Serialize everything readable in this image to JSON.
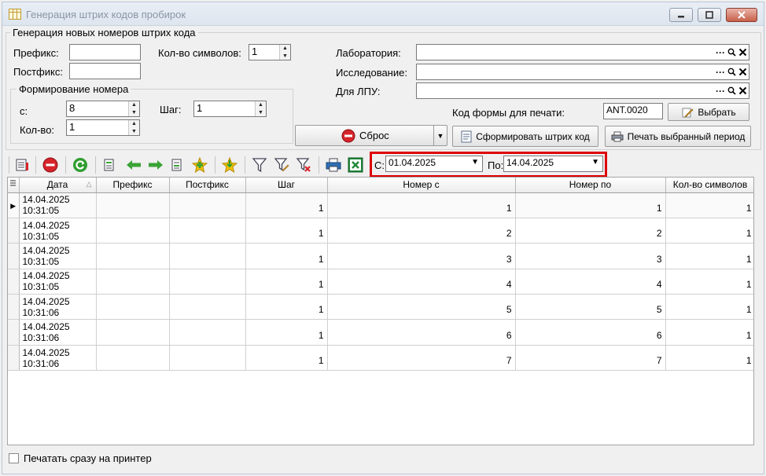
{
  "window": {
    "title": "Генерация штрих кодов пробирок"
  },
  "form": {
    "group_title": "Генерация новых номеров штрих кода",
    "prefix_label": "Префикс:",
    "prefix_value": "",
    "postfix_label": "Постфикс:",
    "postfix_value": "",
    "chars_label": "Кол-во символов:",
    "chars_value": "1",
    "numbering_group": "Формирование номера",
    "from_label": "с:",
    "from_value": "8",
    "step_label": "Шаг:",
    "step_value": "1",
    "count_label": "Кол-во:",
    "count_value": "1",
    "lab_label": "Лаборатория:",
    "lab_value": "",
    "research_label": "Исследование:",
    "research_value": "",
    "lpu_label": "Для ЛПУ:",
    "lpu_value": "",
    "lookup_dots": "···",
    "print_form_label": "Код формы для печати:",
    "print_form_value": "ANT.0020",
    "choose_label": "Выбрать",
    "reset_label": "Сброс",
    "generate_label": "Сформировать штрих код",
    "print_period_label": "Печать выбранный период"
  },
  "filter": {
    "from_label": "С:",
    "from_value": "01.04.2025",
    "to_label": "По:",
    "to_value": "14.04.2025"
  },
  "table": {
    "columns": [
      "Дата",
      "Префикс",
      "Постфикс",
      "Шаг",
      "Номер с",
      "Номер по",
      "Кол-во символов"
    ],
    "rows": [
      {
        "date": "14.04.2025",
        "time": "10:31:05",
        "prefix": "",
        "postfix": "",
        "step": "1",
        "from": "1",
        "to": "1",
        "chars": "1"
      },
      {
        "date": "14.04.2025",
        "time": "10:31:05",
        "prefix": "",
        "postfix": "",
        "step": "1",
        "from": "2",
        "to": "2",
        "chars": "1"
      },
      {
        "date": "14.04.2025",
        "time": "10:31:05",
        "prefix": "",
        "postfix": "",
        "step": "1",
        "from": "3",
        "to": "3",
        "chars": "1"
      },
      {
        "date": "14.04.2025",
        "time": "10:31:05",
        "prefix": "",
        "postfix": "",
        "step": "1",
        "from": "4",
        "to": "4",
        "chars": "1"
      },
      {
        "date": "14.04.2025",
        "time": "10:31:06",
        "prefix": "",
        "postfix": "",
        "step": "1",
        "from": "5",
        "to": "5",
        "chars": "1"
      },
      {
        "date": "14.04.2025",
        "time": "10:31:06",
        "prefix": "",
        "postfix": "",
        "step": "1",
        "from": "6",
        "to": "6",
        "chars": "1"
      },
      {
        "date": "14.04.2025",
        "time": "10:31:06",
        "prefix": "",
        "postfix": "",
        "step": "1",
        "from": "7",
        "to": "7",
        "chars": "1"
      }
    ]
  },
  "footer": {
    "print_direct_label": "Печатать сразу на принтер"
  },
  "colors": {
    "highlight": "#dd0000",
    "reset_icon": "#d6242a",
    "refresh_icon": "#2f9e2f",
    "arrow_icon": "#3aa335",
    "star_icon": "#f2c200"
  },
  "icons": [
    "table-icon",
    "minimize-icon",
    "maximize-icon",
    "close-icon",
    "stop-icon",
    "refresh-icon",
    "arrow-left-icon",
    "arrow-right-icon",
    "add-icon",
    "star-icon",
    "filter-icon",
    "print-icon",
    "excel-icon"
  ]
}
